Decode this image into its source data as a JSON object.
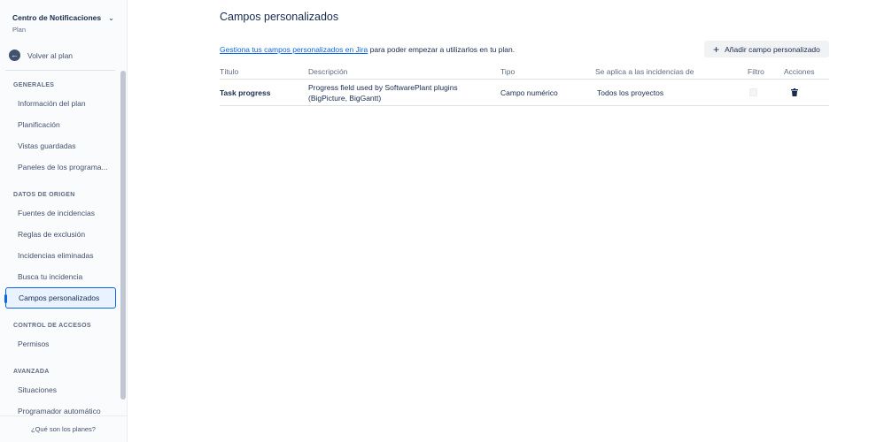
{
  "sidebar": {
    "project_name": "Centro de Notificaciones",
    "project_type": "Plan",
    "back_label": "Volver al plan",
    "sections": [
      {
        "title": "GENERALES",
        "items": [
          "Información del plan",
          "Planificación",
          "Vistas guardadas",
          "Paneles de los programa..."
        ]
      },
      {
        "title": "DATOS DE ORIGEN",
        "items": [
          "Fuentes de incidencias",
          "Reglas de exclusión",
          "Incidencias eliminadas",
          "Busca tu incidencia",
          "Campos personalizados"
        ]
      },
      {
        "title": "CONTROL DE ACCESOS",
        "items": [
          "Permisos"
        ]
      },
      {
        "title": "AVANZADA",
        "items": [
          "Situaciones",
          "Programador automático"
        ]
      }
    ],
    "active_item": "Campos personalizados",
    "footer_link": "¿Qué son los planes?"
  },
  "main": {
    "title": "Campos personalizados",
    "intro_link": "Gestiona tus campos personalizados en Jira",
    "intro_text": " para poder empezar a utilizarlos en tu plan.",
    "add_button_label": "Añadir campo personalizado",
    "table": {
      "headers": [
        "Título",
        "Descripción",
        "Tipo",
        "Se aplica a las incidencias de",
        "Filtro",
        "Acciones"
      ],
      "rows": [
        {
          "title": "Task progress",
          "description_line1": "Progress field used by SoftwarePlant plugins",
          "description_line2": "(BigPicture, BigGantt)",
          "type": "Campo numérico",
          "applies_to": "Todos los proyectos",
          "filter_checked": false
        }
      ]
    }
  },
  "colors": {
    "accent": "#0c66e4",
    "text": "#172b4d",
    "muted": "#5e6c84"
  }
}
